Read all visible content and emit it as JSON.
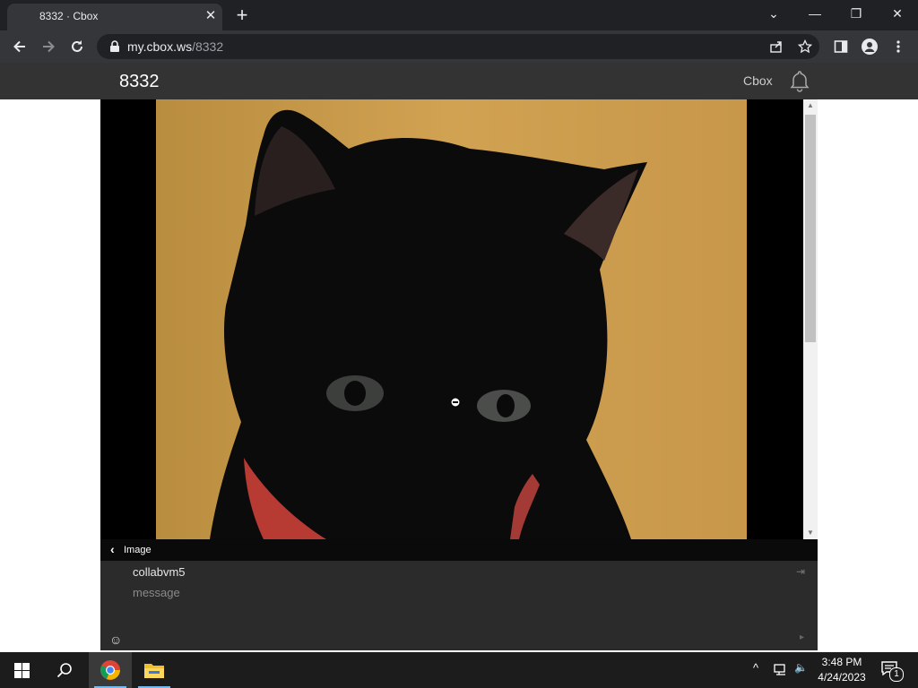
{
  "browser": {
    "tab_title": "8332 · Cbox",
    "tab_close": "✕",
    "new_tab": "+",
    "window_controls": {
      "collapse": "⌄",
      "minimize": "—",
      "restore": "❐",
      "close": "✕"
    },
    "url_host": "my.cbox.ws",
    "url_path": "/8332"
  },
  "cbox": {
    "room_title": "8332",
    "cbox_link": "Cbox",
    "image_bar": {
      "back": "‹",
      "label": "Image"
    },
    "chat": {
      "username": "collabvm5",
      "message_placeholder": "message",
      "emoji": "☺",
      "send": "▸",
      "logout": "⇥"
    }
  },
  "taskbar": {
    "time": "3:48 PM",
    "date": "4/24/2023",
    "notification_count": "1",
    "tray": {
      "chevron": "^",
      "volume": "🔈"
    }
  },
  "colors": {
    "tab_strip": "#202124",
    "toolbar": "#35363a",
    "cbox_header": "#333333",
    "message_area": "#2b2b2b",
    "taskbar": "#1c1c1c",
    "photo_background": "#c99a47"
  }
}
